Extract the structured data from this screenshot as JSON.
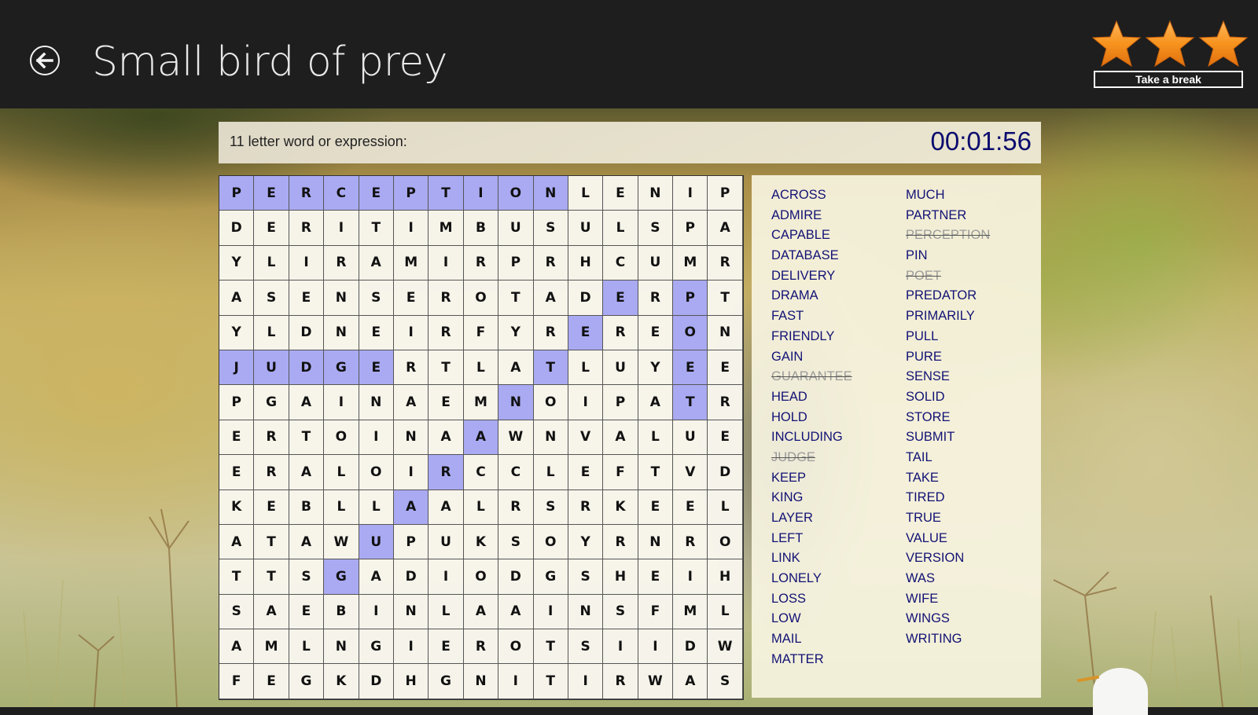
{
  "header": {
    "title": "Small bird of prey",
    "back_icon": "back-arrow-circle-icon",
    "stars_earned": 3,
    "stars_total": 3,
    "star_color": "#f7931e",
    "take_break_label": "Take a break"
  },
  "clue": {
    "text": "11 letter word or expression:",
    "timer": "00:01:56"
  },
  "grid": {
    "found_color": "#aaaaf3",
    "rows": [
      [
        "P",
        "E",
        "R",
        "C",
        "E",
        "P",
        "T",
        "I",
        "O",
        "N",
        "L",
        "E",
        "N",
        "I",
        "P"
      ],
      [
        "D",
        "E",
        "R",
        "I",
        "T",
        "I",
        "M",
        "B",
        "U",
        "S",
        "U",
        "L",
        "S",
        "P",
        "A"
      ],
      [
        "Y",
        "L",
        "I",
        "R",
        "A",
        "M",
        "I",
        "R",
        "P",
        "R",
        "H",
        "C",
        "U",
        "M",
        "R"
      ],
      [
        "A",
        "S",
        "E",
        "N",
        "S",
        "E",
        "R",
        "O",
        "T",
        "A",
        "D",
        "E",
        "R",
        "P",
        "T"
      ],
      [
        "Y",
        "L",
        "D",
        "N",
        "E",
        "I",
        "R",
        "F",
        "Y",
        "R",
        "E",
        "R",
        "E",
        "O",
        "N"
      ],
      [
        "J",
        "U",
        "D",
        "G",
        "E",
        "R",
        "T",
        "L",
        "A",
        "T",
        "L",
        "U",
        "Y",
        "E",
        "E"
      ],
      [
        "P",
        "G",
        "A",
        "I",
        "N",
        "A",
        "E",
        "M",
        "N",
        "O",
        "I",
        "P",
        "A",
        "T",
        "R"
      ],
      [
        "E",
        "R",
        "T",
        "O",
        "I",
        "N",
        "A",
        "A",
        "W",
        "N",
        "V",
        "A",
        "L",
        "U",
        "E"
      ],
      [
        "E",
        "R",
        "A",
        "L",
        "O",
        "I",
        "R",
        "C",
        "C",
        "L",
        "E",
        "F",
        "T",
        "V",
        "D"
      ],
      [
        "K",
        "E",
        "B",
        "L",
        "L",
        "A",
        "A",
        "L",
        "R",
        "S",
        "R",
        "K",
        "E",
        "E",
        "L"
      ],
      [
        "A",
        "T",
        "A",
        "W",
        "U",
        "P",
        "U",
        "K",
        "S",
        "O",
        "Y",
        "R",
        "N",
        "R",
        "O"
      ],
      [
        "T",
        "T",
        "S",
        "G",
        "A",
        "D",
        "I",
        "O",
        "D",
        "G",
        "S",
        "H",
        "E",
        "I",
        "H"
      ],
      [
        "S",
        "A",
        "E",
        "B",
        "I",
        "N",
        "L",
        "A",
        "A",
        "I",
        "N",
        "S",
        "F",
        "M",
        "L"
      ],
      [
        "A",
        "M",
        "L",
        "N",
        "G",
        "I",
        "E",
        "R",
        "O",
        "T",
        "S",
        "I",
        "I",
        "D",
        "W"
      ],
      [
        "F",
        "E",
        "G",
        "K",
        "D",
        "H",
        "G",
        "N",
        "I",
        "T",
        "I",
        "R",
        "W",
        "A",
        "S"
      ]
    ],
    "found_cells": [
      [
        0,
        0
      ],
      [
        0,
        1
      ],
      [
        0,
        2
      ],
      [
        0,
        3
      ],
      [
        0,
        4
      ],
      [
        0,
        5
      ],
      [
        0,
        6
      ],
      [
        0,
        7
      ],
      [
        0,
        8
      ],
      [
        0,
        9
      ],
      [
        5,
        0
      ],
      [
        5,
        1
      ],
      [
        5,
        2
      ],
      [
        5,
        3
      ],
      [
        5,
        4
      ],
      [
        11,
        3
      ],
      [
        10,
        4
      ],
      [
        9,
        5
      ],
      [
        8,
        6
      ],
      [
        7,
        7
      ],
      [
        6,
        8
      ],
      [
        5,
        9
      ],
      [
        4,
        10
      ],
      [
        3,
        11
      ],
      [
        3,
        13
      ],
      [
        4,
        13
      ],
      [
        5,
        13
      ],
      [
        6,
        13
      ]
    ]
  },
  "word_list": {
    "column1": [
      {
        "word": "ACROSS",
        "found": false
      },
      {
        "word": "ADMIRE",
        "found": false
      },
      {
        "word": "CAPABLE",
        "found": false
      },
      {
        "word": "DATABASE",
        "found": false
      },
      {
        "word": "DELIVERY",
        "found": false
      },
      {
        "word": "DRAMA",
        "found": false
      },
      {
        "word": "FAST",
        "found": false
      },
      {
        "word": "FRIENDLY",
        "found": false
      },
      {
        "word": "GAIN",
        "found": false
      },
      {
        "word": "GUARANTEE",
        "found": true
      },
      {
        "word": "HEAD",
        "found": false
      },
      {
        "word": "HOLD",
        "found": false
      },
      {
        "word": "INCLUDING",
        "found": false
      },
      {
        "word": "JUDGE",
        "found": true
      },
      {
        "word": "KEEP",
        "found": false
      },
      {
        "word": "KING",
        "found": false
      },
      {
        "word": "LAYER",
        "found": false
      },
      {
        "word": "LEFT",
        "found": false
      },
      {
        "word": "LINK",
        "found": false
      },
      {
        "word": "LONELY",
        "found": false
      },
      {
        "word": "LOSS",
        "found": false
      },
      {
        "word": "LOW",
        "found": false
      },
      {
        "word": "MAIL",
        "found": false
      },
      {
        "word": "MATTER",
        "found": false
      }
    ],
    "column2": [
      {
        "word": "MUCH",
        "found": false
      },
      {
        "word": "PARTNER",
        "found": false
      },
      {
        "word": "PERCEPTION",
        "found": true
      },
      {
        "word": "PIN",
        "found": false
      },
      {
        "word": "POET",
        "found": true
      },
      {
        "word": "PREDATOR",
        "found": false
      },
      {
        "word": "PRIMARILY",
        "found": false
      },
      {
        "word": "PULL",
        "found": false
      },
      {
        "word": "PURE",
        "found": false
      },
      {
        "word": "SENSE",
        "found": false
      },
      {
        "word": "SOLID",
        "found": false
      },
      {
        "word": "STORE",
        "found": false
      },
      {
        "word": "SUBMIT",
        "found": false
      },
      {
        "word": "TAIL",
        "found": false
      },
      {
        "word": "TAKE",
        "found": false
      },
      {
        "word": "TIRED",
        "found": false
      },
      {
        "word": "TRUE",
        "found": false
      },
      {
        "word": "VALUE",
        "found": false
      },
      {
        "word": "VERSION",
        "found": false
      },
      {
        "word": "WAS",
        "found": false
      },
      {
        "word": "WIFE",
        "found": false
      },
      {
        "word": "WINGS",
        "found": false
      },
      {
        "word": "WRITING",
        "found": false
      }
    ]
  }
}
